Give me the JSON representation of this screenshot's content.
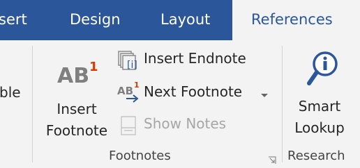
{
  "tabs": [
    {
      "label": "sert"
    },
    {
      "label": "Design"
    },
    {
      "label": "Layout"
    },
    {
      "label": "References"
    }
  ],
  "left_cut_label": "ble",
  "footnotes": {
    "insert_footnote_line1": "Insert",
    "insert_footnote_line2": "Footnote",
    "ab_glyph": "AB",
    "ab_sup": "1",
    "insert_endnote": "Insert Endnote",
    "next_footnote": "Next Footnote",
    "show_notes": "Show Notes",
    "group_label": "Footnotes"
  },
  "research": {
    "smart_lookup_line1": "Smart",
    "smart_lookup_line2": "Lookup",
    "group_label": "Research"
  },
  "colors": {
    "tab_bar": "#2b579a",
    "ribbon_bg": "#f3f3f3",
    "accent_red": "#d83b01",
    "icon_blue": "#2b579a"
  }
}
